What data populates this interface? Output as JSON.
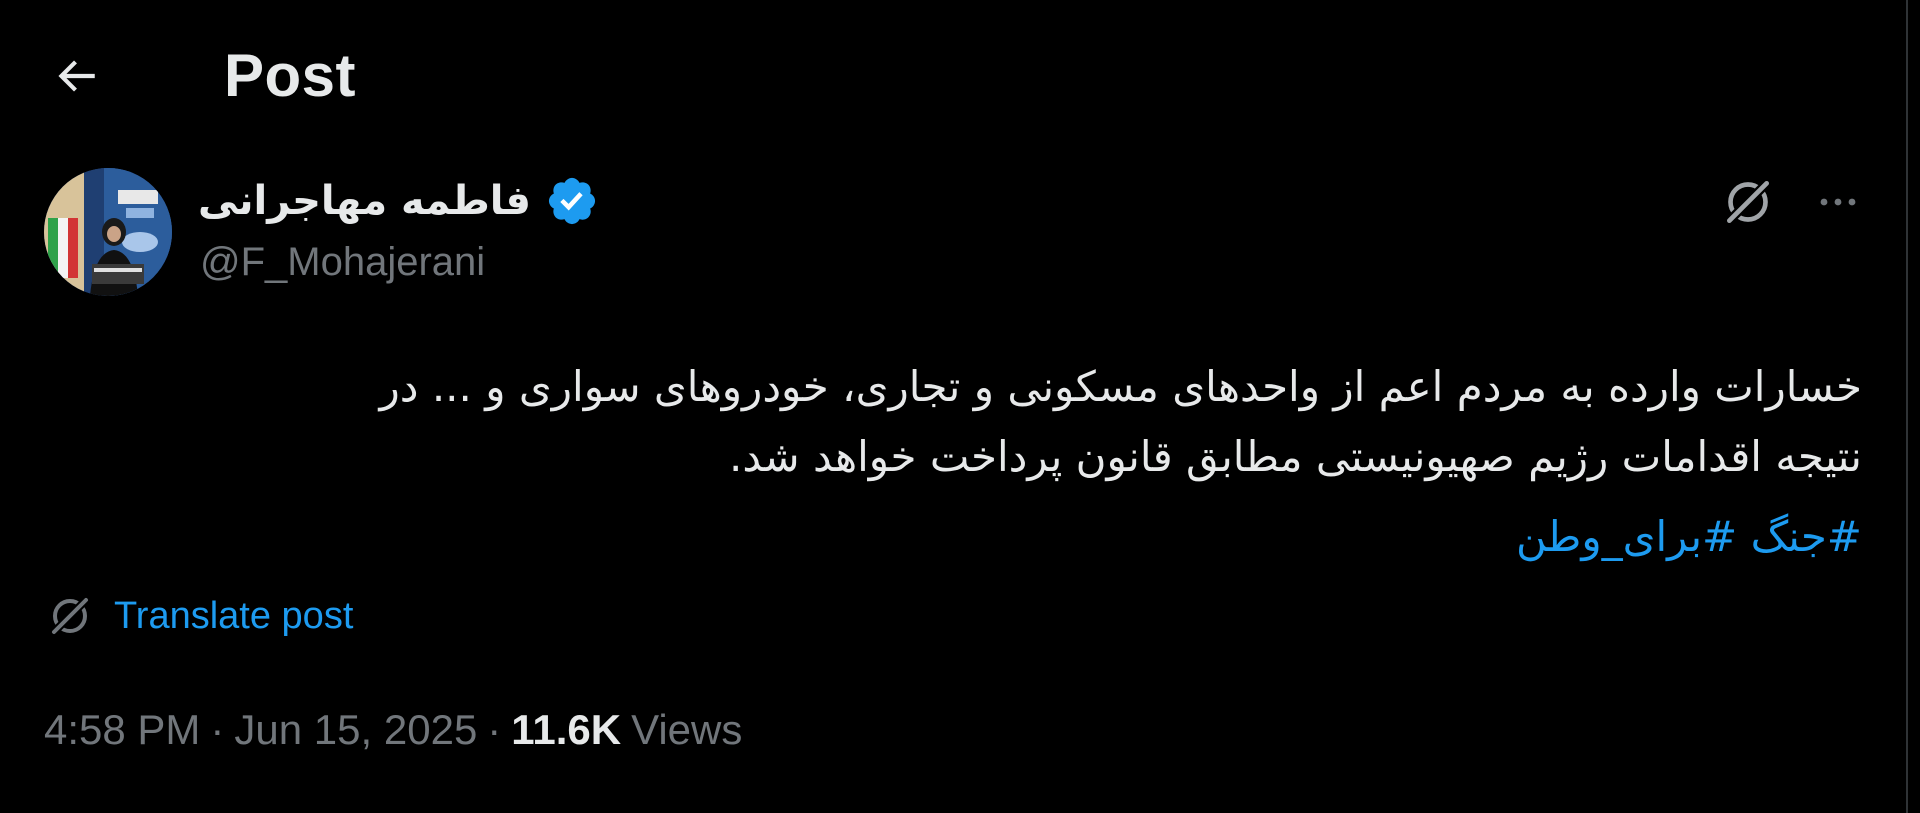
{
  "header": {
    "title": "Post"
  },
  "author": {
    "display_name": "فاطمه مهاجرانی",
    "handle": "@F_Mohajerani",
    "verified": true
  },
  "post": {
    "text_lines": [
      "خسارات وارده به مردم اعم از واحدهای مسکونی و تجاری، خودروهای سواری و ... در",
      "نتیجه اقدامات رژیم صهیونیستی مطابق قانون پرداخت خواهد شد."
    ],
    "hashtags": [
      "#جنگ",
      "#برای_وطن"
    ],
    "translate_label": "Translate post"
  },
  "meta": {
    "time": "4:58 PM",
    "separator": "·",
    "date": "Jun 15, 2025",
    "views_count": "11.6K",
    "views_label": "Views"
  },
  "colors": {
    "background": "#000000",
    "text": "#e7e9ea",
    "secondary": "#71767b",
    "accent": "#1d9bf0"
  },
  "icons": {
    "back": "arrow-left-icon",
    "verified": "verified-badge-icon",
    "grok": "grok-icon",
    "more": "more-horizontal-icon",
    "translate": "translate-icon"
  }
}
